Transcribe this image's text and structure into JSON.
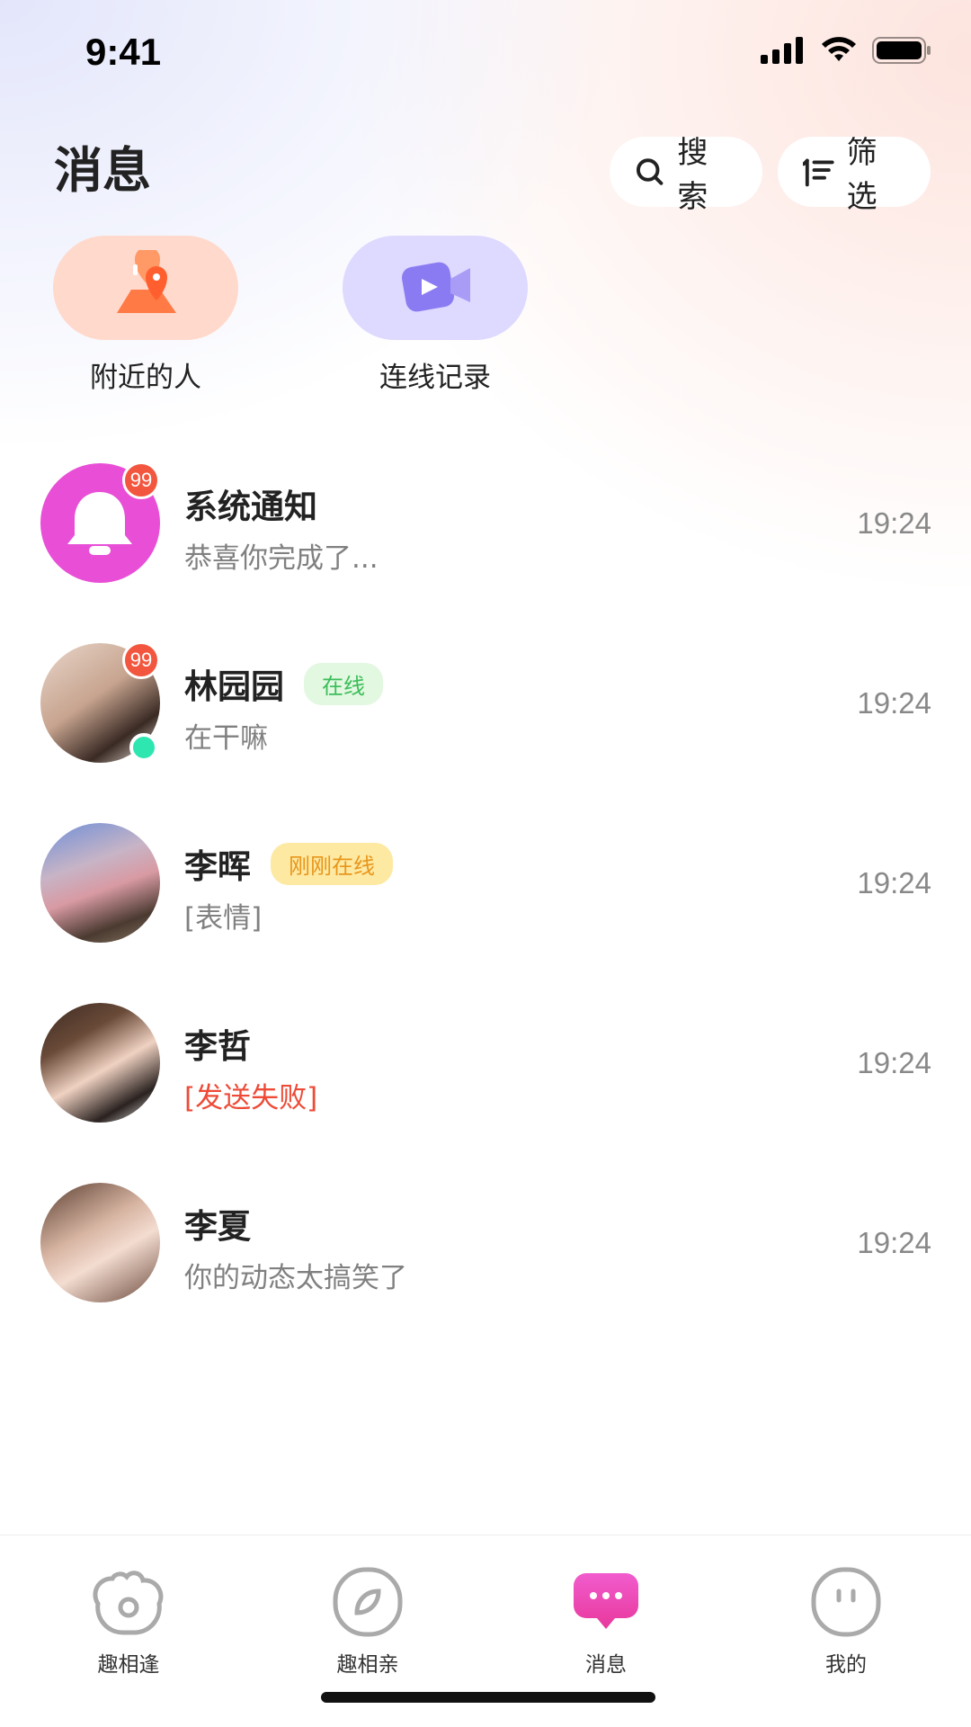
{
  "status_bar": {
    "time": "9:41"
  },
  "header": {
    "title": "消息",
    "search_label": "搜索",
    "filter_label": "筛选"
  },
  "quick_entries": [
    {
      "label": "附近的人",
      "icon": "location-icon",
      "color": "#ffd9cc"
    },
    {
      "label": "连线记录",
      "icon": "video-call-icon",
      "color": "#ddd9ff"
    }
  ],
  "conversations": [
    {
      "name": "系统通知",
      "message": "恭喜你完成了...",
      "time": "19:24",
      "badge": "99",
      "avatar": "bell-icon",
      "tag": "",
      "online": false,
      "failed": false
    },
    {
      "name": "林园园",
      "message": "在干嘛",
      "time": "19:24",
      "badge": "99",
      "avatar": "user-photo",
      "tag": "在线",
      "online": true,
      "failed": false
    },
    {
      "name": "李晖",
      "message": "[表情]",
      "time": "19:24",
      "badge": "",
      "avatar": "user-photo",
      "tag": "刚刚在线",
      "online": false,
      "failed": false
    },
    {
      "name": "李哲",
      "message": "[发送失败]",
      "time": "19:24",
      "badge": "",
      "avatar": "user-photo",
      "tag": "",
      "online": false,
      "failed": true
    },
    {
      "name": "李夏",
      "message": "你的动态太搞笑了",
      "time": "19:24",
      "badge": "",
      "avatar": "user-photo",
      "tag": "",
      "online": false,
      "failed": false
    }
  ],
  "tabbar": {
    "tabs": [
      {
        "label": "趣相逢",
        "icon": "meet-icon"
      },
      {
        "label": "趣相亲",
        "icon": "compass-icon"
      },
      {
        "label": "消息",
        "icon": "chat-bubble-icon",
        "active": true
      },
      {
        "label": "我的",
        "icon": "profile-face-icon"
      }
    ]
  },
  "colors": {
    "accent_pink": "#e84fd6",
    "badge_red": "#f3563e",
    "online_green": "#2ee6b0",
    "failed_red": "#ee4a36"
  }
}
